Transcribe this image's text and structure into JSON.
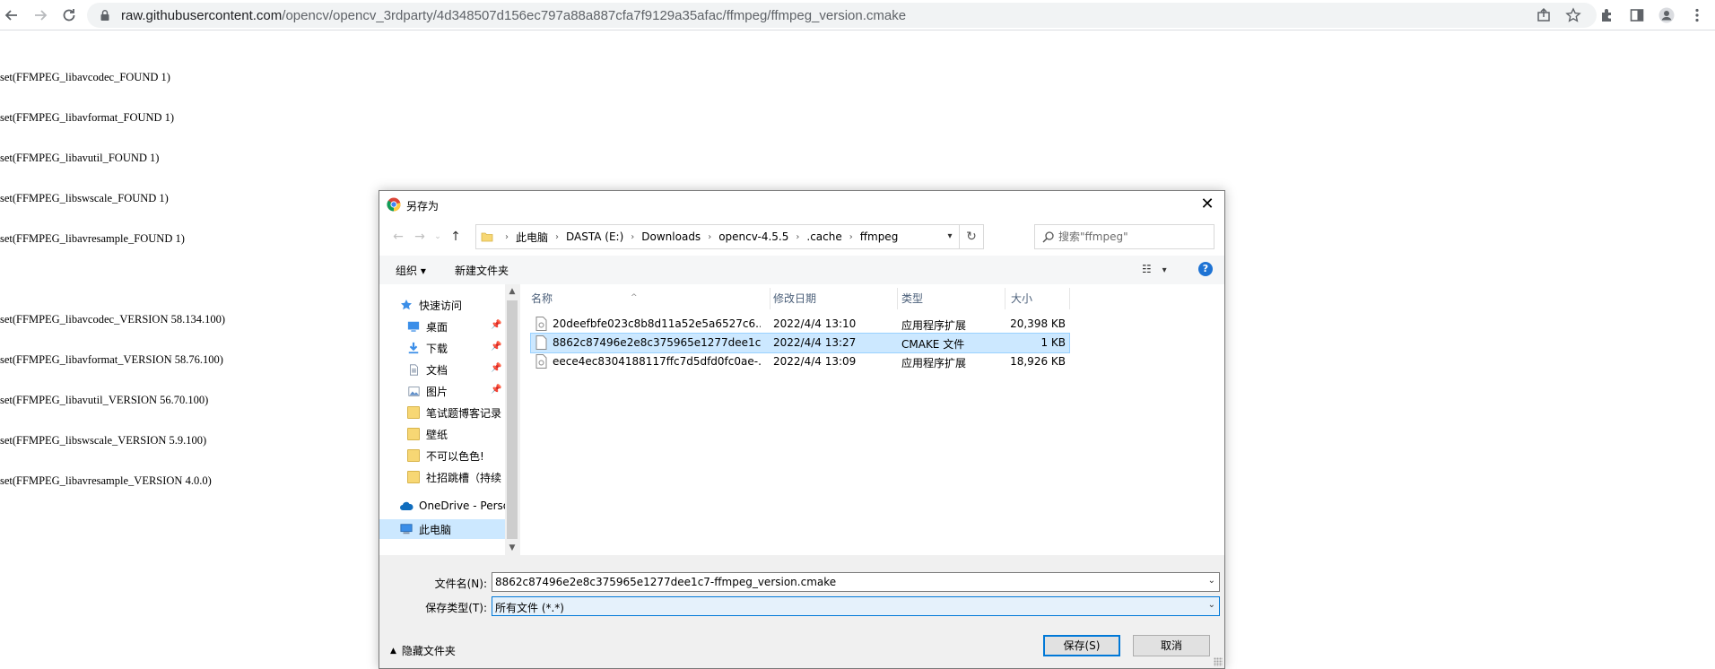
{
  "browser": {
    "url_host": "raw.githubusercontent.com",
    "url_path": "/opencv/opencv_3rdparty/4d348507d156ec797a88a887cfa7f9129a35afac/ffmpeg/ffmpeg_version.cmake"
  },
  "page": {
    "lines": [
      "set(FFMPEG_libavcodec_FOUND 1)",
      "set(FFMPEG_libavformat_FOUND 1)",
      "set(FFMPEG_libavutil_FOUND 1)",
      "set(FFMPEG_libswscale_FOUND 1)",
      "set(FFMPEG_libavresample_FOUND 1)",
      "",
      "set(FFMPEG_libavcodec_VERSION 58.134.100)",
      "set(FFMPEG_libavformat_VERSION 58.76.100)",
      "set(FFMPEG_libavutil_VERSION 56.70.100)",
      "set(FFMPEG_libswscale_VERSION 5.9.100)",
      "set(FFMPEG_libavresample_VERSION 4.0.0)"
    ]
  },
  "dialog": {
    "title": "另存为",
    "close": "✕",
    "breadcrumbs": [
      "此电脑",
      "DASTA (E:)",
      "Downloads",
      "opencv-4.5.5",
      ".cache",
      "ffmpeg"
    ],
    "search_placeholder": "搜索\"ffmpeg\"",
    "organize": "组织 ▾",
    "new_folder": "新建文件夹",
    "help": "?",
    "nav": {
      "quick_access": "快速访问",
      "items": [
        "桌面",
        "下载",
        "文档",
        "图片",
        "笔试题博客记录",
        "壁纸",
        "不可以色色!",
        "社招跳槽（持续"
      ],
      "onedrive": "OneDrive - Perso",
      "this_pc": "此电脑"
    },
    "columns": [
      "名称",
      "修改日期",
      "类型",
      "大小"
    ],
    "files": [
      {
        "name": "20deefbfe023c8b8d11a52e5a6527c6...",
        "date": "2022/4/4 13:10",
        "type": "应用程序扩展",
        "size": "20,398 KB"
      },
      {
        "name": "8862c87496e2e8c375965e1277dee1c...",
        "date": "2022/4/4 13:27",
        "type": "CMAKE 文件",
        "size": "1 KB"
      },
      {
        "name": "eece4ec8304188117ffc7d5dfd0fc0ae-...",
        "date": "2022/4/4 13:09",
        "type": "应用程序扩展",
        "size": "18,926 KB"
      }
    ],
    "filename_label": "文件名(N):",
    "filename_value": "8862c87496e2e8c375965e1277dee1c7-ffmpeg_version.cmake",
    "filetype_label": "保存类型(T):",
    "filetype_value": "所有文件 (*.*)",
    "hide_folders": "隐藏文件夹",
    "save": "保存(S)",
    "cancel": "取消"
  },
  "colors": {
    "accent": "#0078d7",
    "selection": "#cce8ff",
    "help": "#1e73d4"
  }
}
